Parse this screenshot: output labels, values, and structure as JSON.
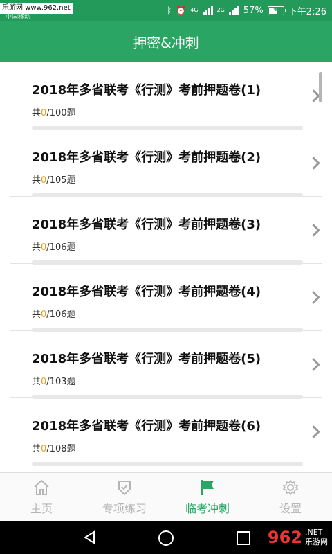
{
  "status_bar": {
    "watermark": "乐游网 www.962.net",
    "carrier": "中国移动",
    "network_1": "4G",
    "network_2": "2G",
    "battery": "57%",
    "battery_level": 0.57,
    "time": "下午2:26"
  },
  "header": {
    "title": "押密&冲刺"
  },
  "items": [
    {
      "title": "2018年多省联考《行测》考前押题卷(1)",
      "prefix": "共",
      "done": "0",
      "total": "/100题",
      "progress": 0
    },
    {
      "title": "2018年多省联考《行测》考前押题卷(2)",
      "prefix": "共",
      "done": "0",
      "total": "/105题",
      "progress": 0
    },
    {
      "title": "2018年多省联考《行测》考前押题卷(3)",
      "prefix": "共",
      "done": "0",
      "total": "/106题",
      "progress": 0
    },
    {
      "title": "2018年多省联考《行测》考前押题卷(4)",
      "prefix": "共",
      "done": "0",
      "total": "/106题",
      "progress": 0
    },
    {
      "title": "2018年多省联考《行测》考前押题卷(5)",
      "prefix": "共",
      "done": "0",
      "total": "/103题",
      "progress": 0
    },
    {
      "title": "2018年多省联考《行测》考前押题卷(6)",
      "prefix": "共",
      "done": "0",
      "total": "/108题",
      "progress": 0
    }
  ],
  "tabs": [
    {
      "label": "主页",
      "icon": "home-icon",
      "active": false
    },
    {
      "label": "专项练习",
      "icon": "shield-check-icon",
      "active": false
    },
    {
      "label": "临考冲刺",
      "icon": "flag-icon",
      "active": true
    },
    {
      "label": "设置",
      "icon": "gear-icon",
      "active": false
    }
  ],
  "bottom_watermark": {
    "logo": "962",
    "text": "乐游网",
    "suffix": ".NET"
  },
  "colors": {
    "primary": "#2aa563",
    "status_bar": "#239a5a",
    "done_count": "#e0a21f",
    "inactive": "#b5b5b5"
  }
}
